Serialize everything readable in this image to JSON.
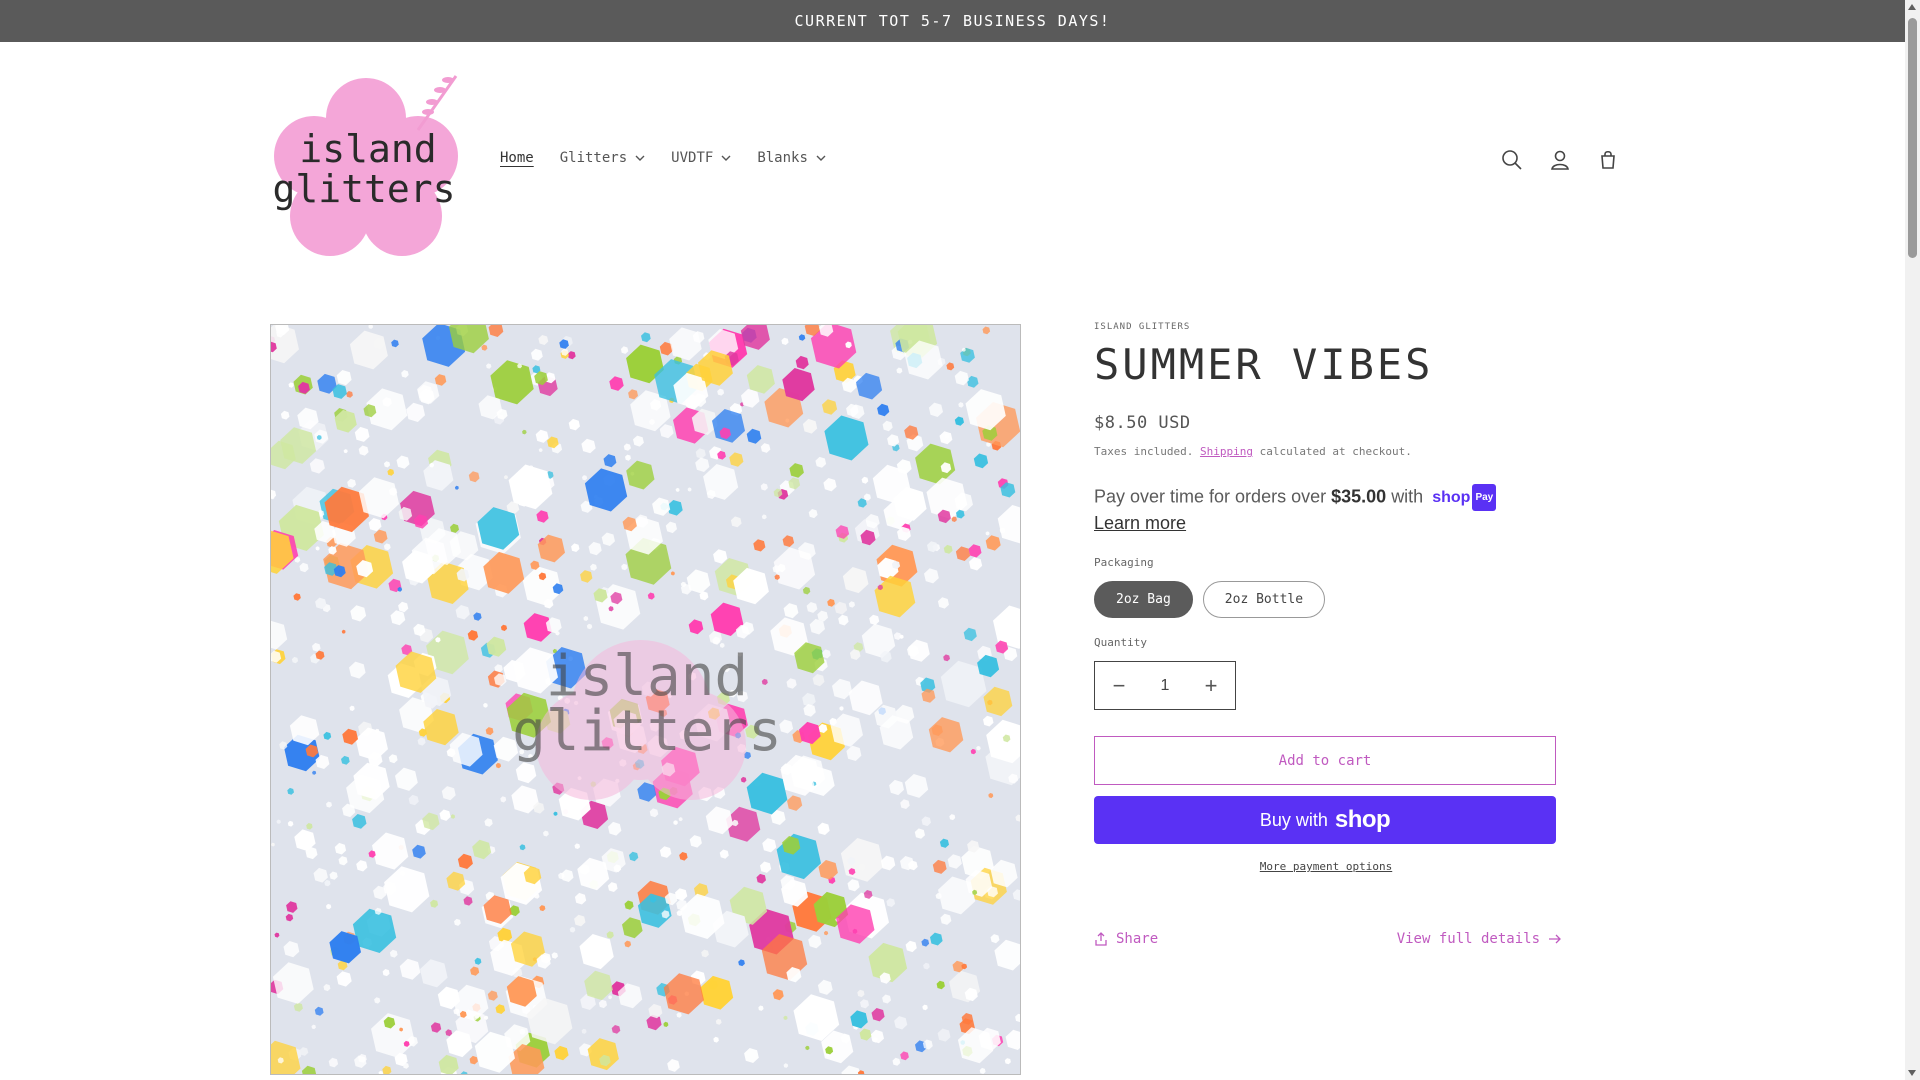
{
  "announcement": "CURRENT TOT 5-7 BUSINESS DAYS!",
  "logo": {
    "line1": "island",
    "line2": "glitters"
  },
  "nav": {
    "items": [
      {
        "label": "Home",
        "dropdown": false,
        "active": true
      },
      {
        "label": "Glitters",
        "dropdown": true
      },
      {
        "label": "UVDTF",
        "dropdown": true
      },
      {
        "label": "Blanks",
        "dropdown": true
      }
    ]
  },
  "header_icons": [
    "search-icon",
    "account-icon",
    "cart-icon"
  ],
  "gallery": {
    "watermark_line1": "island",
    "watermark_line2": "glitters"
  },
  "product": {
    "vendor": "ISLAND GLITTERS",
    "title": "SUMMER VIBES",
    "price": "$8.50 USD",
    "tax_prefix": "Taxes included.",
    "tax_link": "Shipping",
    "tax_suffix": "calculated at checkout.",
    "installments_prefix": "Pay over time for orders over",
    "installments_amount": "$35.00",
    "installments_with": "with",
    "shop_pay_word": "shop",
    "shop_pay_badge": "Pay",
    "learn_more": "Learn more",
    "packaging_label": "Packaging",
    "packaging_options": [
      "2oz Bag",
      "2oz Bottle"
    ],
    "packaging_selected": "2oz Bag",
    "quantity_label": "Quantity",
    "quantity_value": "1",
    "add_to_cart": "Add to cart",
    "buy_with": "Buy with",
    "buy_shop_word": "shop",
    "more_payment": "More payment options",
    "share": "Share",
    "view_full": "View full details"
  },
  "colors": {
    "accent": "#c05ac0",
    "shop_purple": "#5a31f4",
    "announce_bg": "#5a5a5a",
    "logo_pink": "#f4a6d8"
  }
}
